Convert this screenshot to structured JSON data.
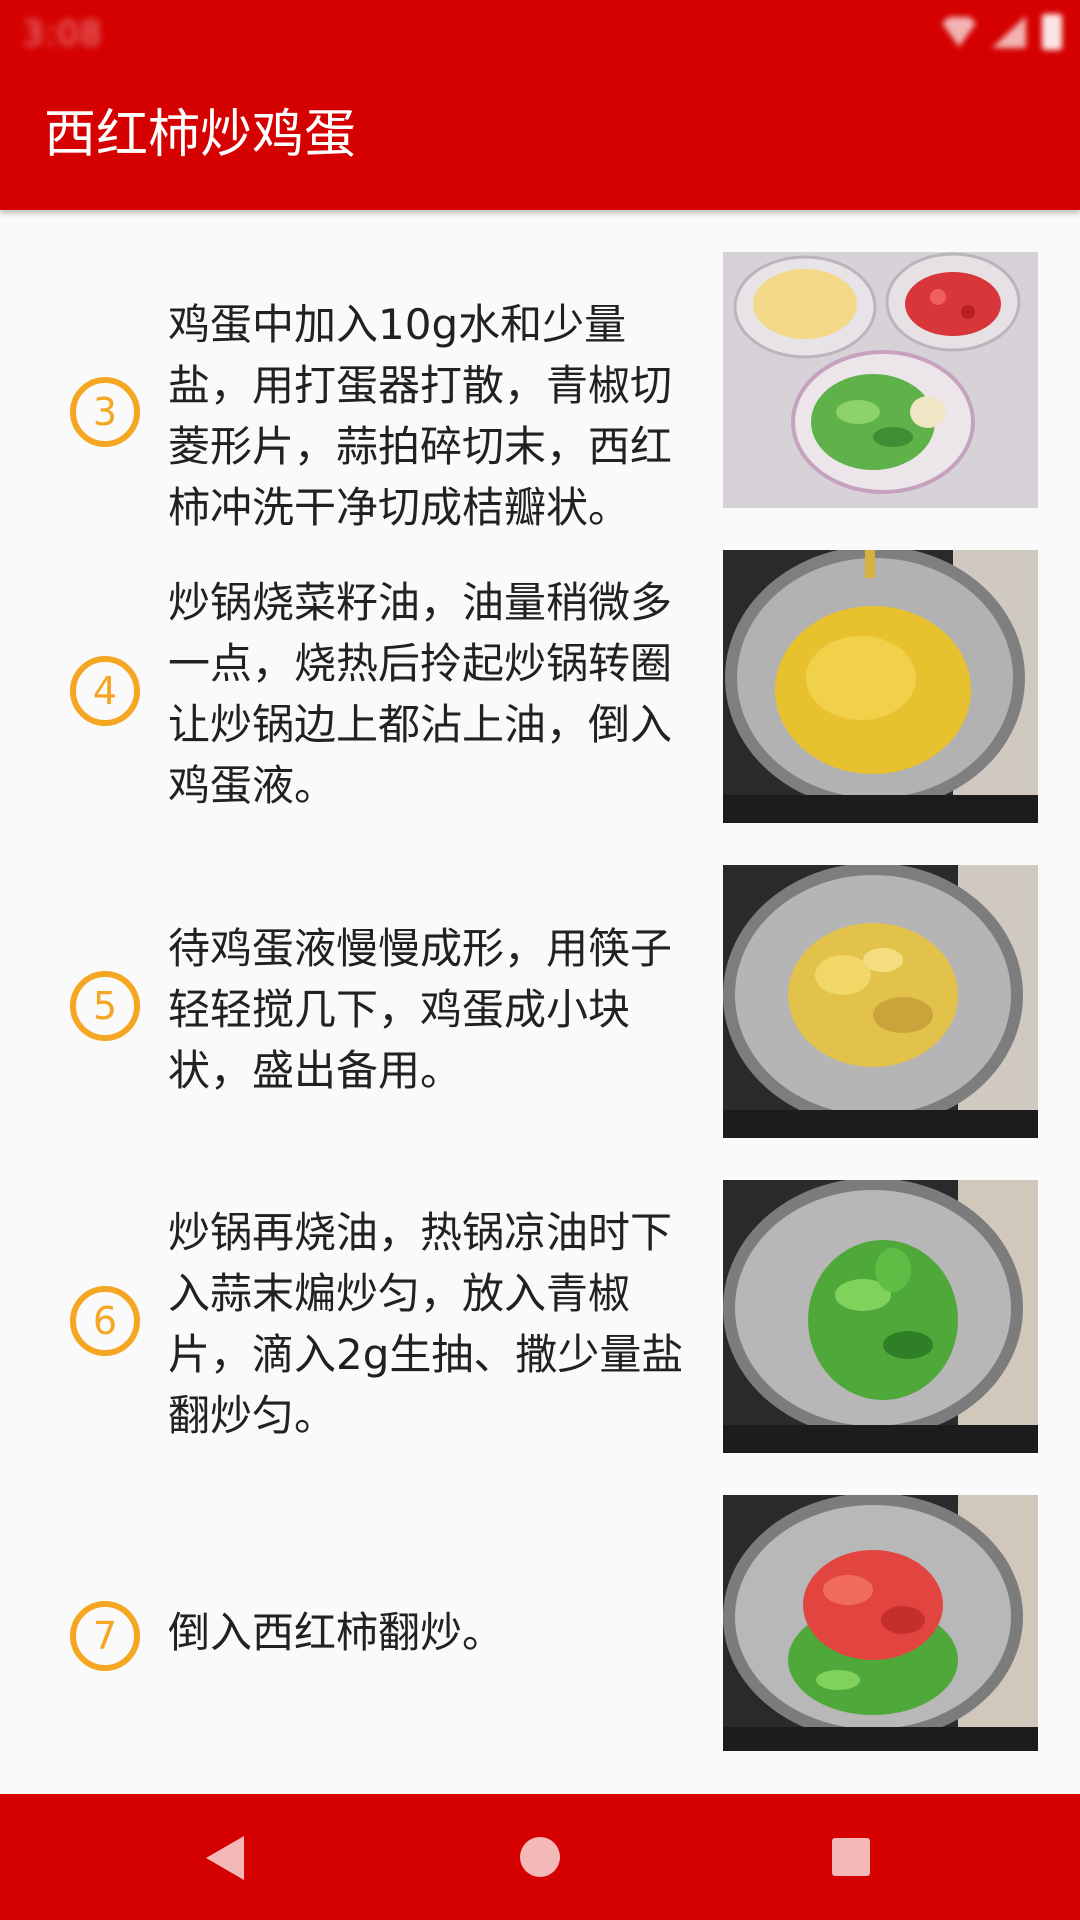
{
  "status_bar": {
    "time": "3:08"
  },
  "app_bar": {
    "title": "西红柿炒鸡蛋"
  },
  "steps": [
    {
      "number": "3",
      "text": "鸡蛋中加入10g水和少量盐，用打蛋器打散，青椒切菱形片，蒜拍碎切末，西红柿冲洗干净切成桔瓣状。"
    },
    {
      "number": "4",
      "text": "炒锅烧菜籽油，油量稍微多一点，烧热后拎起炒锅转圈让炒锅边上都沾上油，倒入鸡蛋液。"
    },
    {
      "number": "5",
      "text": "待鸡蛋液慢慢成形，用筷子轻轻搅几下，鸡蛋成小块状，盛出备用。"
    },
    {
      "number": "6",
      "text": "炒锅再烧油，热锅凉油时下入蒜末煸炒匀，放入青椒片，滴入2g生抽、撒少量盐翻炒匀。"
    },
    {
      "number": "7",
      "text": "倒入西红柿翻炒。"
    }
  ]
}
